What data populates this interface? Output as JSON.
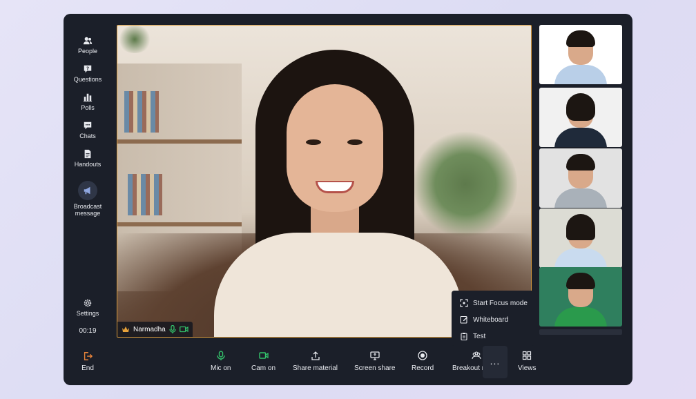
{
  "sidebar": {
    "items": [
      {
        "label": "People",
        "icon": "people-icon"
      },
      {
        "label": "Questions",
        "icon": "question-icon"
      },
      {
        "label": "Polls",
        "icon": "polls-icon"
      },
      {
        "label": "Chats",
        "icon": "chat-icon"
      },
      {
        "label": "Handouts",
        "icon": "handout-icon"
      },
      {
        "label_line1": "Broadcast",
        "label_line2": "message",
        "icon": "megaphone-icon"
      }
    ],
    "settings_label": "Settings",
    "timer": "00:19",
    "end_label": "End"
  },
  "main_video": {
    "presenter_name": "Narmadha",
    "accent_color": "#d99a3c"
  },
  "participants": [
    {
      "bg": "#ffffff",
      "shirt": "#b9cfe8"
    },
    {
      "bg": "#f1f1f1",
      "shirt": "#1f2a3a"
    },
    {
      "bg": "#e2e2e2",
      "shirt": "#a9b1b9"
    },
    {
      "bg": "#dcdcd4",
      "shirt": "#c9dbef"
    },
    {
      "bg": "#2f7f5e",
      "shirt": "#2a9a4c"
    }
  ],
  "more_menu": {
    "items": [
      {
        "label": "Start Focus mode",
        "icon": "focus-icon"
      },
      {
        "label": "Whiteboard",
        "icon": "edit-icon"
      },
      {
        "label": "Test",
        "icon": "clipboard-icon"
      }
    ]
  },
  "toolbar": {
    "mic_label": "Mic on",
    "cam_label": "Cam on",
    "share_material_label": "Share material",
    "screen_share_label": "Screen share",
    "record_label": "Record",
    "breakout_label": "Breakout rooms",
    "views_label": "Views",
    "more_label": "..."
  },
  "colors": {
    "mic_green": "#33c36b",
    "end_orange": "#e8833a"
  }
}
